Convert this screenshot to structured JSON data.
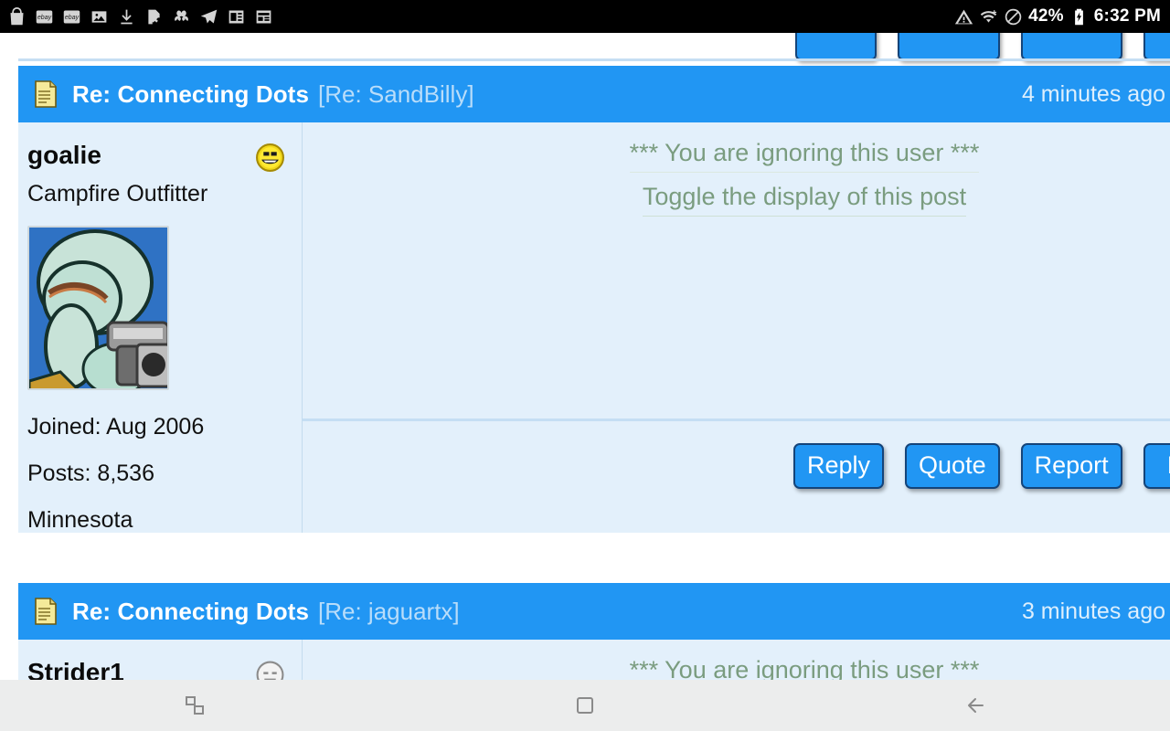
{
  "status_bar": {
    "left_icons": [
      "shopping-bag-icon",
      "ebay-icon",
      "ebay-icon",
      "photo-icon",
      "download-icon",
      "document-cancel-icon",
      "pinwheel-icon",
      "telegram-icon",
      "news-list-icon",
      "news-grid-icon"
    ],
    "right_icons": [
      "warning-icon",
      "wifi-icon",
      "do-not-disturb-icon",
      "battery-charging-icon"
    ],
    "battery_percent": "42%",
    "clock": "6:32 PM"
  },
  "colors": {
    "header_blue": "#2196f3",
    "post_background": "#e3f0fb",
    "button_border": "#14447a",
    "ignore_text": "#7a9c7f",
    "subject_blue": "#b9ddfa",
    "status_bar_background": "#000000",
    "nav_bar_background": "#eceded"
  },
  "posts": [
    {
      "icon": "note-icon",
      "title": "Re: Connecting Dots",
      "subject": "[Re: SandBilly]",
      "time": "4 minutes ago",
      "author": {
        "username": "goalie",
        "rank": "Campfire Outfitter",
        "mood_icon": "yellow-smiley-icon",
        "avatar": "squidward-avatar",
        "joined": "Joined: Aug 2006",
        "posts": "Posts: 8,536",
        "location": "Minnesota"
      },
      "ignore_notice": "*** You are ignoring this user ***",
      "toggle_link": "Toggle the display of this post",
      "buttons": [
        "Reply",
        "Quote",
        "Report",
        "Edit"
      ]
    },
    {
      "icon": "note-icon",
      "title": "Re: Connecting Dots",
      "subject": "[Re: jaguartx]",
      "time": "3 minutes ago",
      "author": {
        "username": "Strider1",
        "mood_icon": "gray-neutral-smiley-icon"
      },
      "ignore_notice": "*** You are ignoring this user ***"
    }
  ],
  "nav_bar": {
    "recents_label": "recents-icon",
    "home_label": "home-icon",
    "back_label": "back-icon"
  }
}
